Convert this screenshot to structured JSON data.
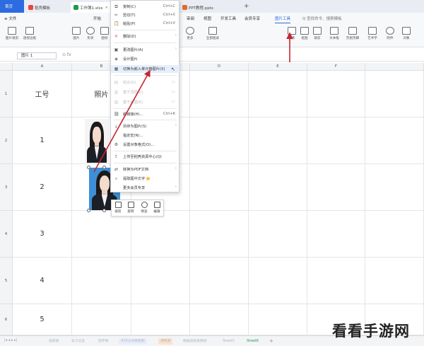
{
  "tabs": {
    "home": "首页",
    "items": [
      {
        "label": "稻壳模板",
        "color": "#e8463c"
      },
      {
        "label": "工作簿1.xlsx",
        "color": "#1e9a4f",
        "close": "×"
      },
      {
        "label": "PPT教程.pptx",
        "color": "#e06b2c"
      }
    ],
    "add": "+"
  },
  "menubar": {
    "items": [
      "≡ 文件",
      "开始",
      "审阅",
      "视图",
      "开发工具",
      "会员专享",
      "图片工具"
    ],
    "active": "图片工具",
    "search_hint": "Q 查找命令、搜索模板"
  },
  "ribbon": {
    "left": [
      "图片裁剪",
      "透视边框",
      "图片",
      "形状",
      "图标"
    ],
    "right": [
      "更多",
      "全部图表",
      "线条",
      "抠图",
      "裁剪",
      "文本框",
      "页眉页脚",
      "艺术字",
      "附件",
      "对象"
    ],
    "extra": [
      "数据透视图"
    ]
  },
  "formula": {
    "name_box": "图片 1",
    "fx": "⊙  fx"
  },
  "columns": [
    "A",
    "B",
    "C",
    "D",
    "E",
    "F"
  ],
  "rows": [
    "1",
    "2",
    "3",
    "4",
    "5",
    "6"
  ],
  "cells": {
    "a1": "工号",
    "b1": "照片",
    "a2": "1",
    "a3": "2",
    "a4": "3",
    "a5": "4",
    "a6": "5"
  },
  "context_menu": [
    {
      "icon": "⧉",
      "label": "复制(C)",
      "shortcut": "Ctrl+C"
    },
    {
      "icon": "✂",
      "label": "剪切(T)",
      "shortcut": "Ctrl+X"
    },
    {
      "icon": "📋",
      "label": "粘贴(P)",
      "shortcut": "Ctrl+V"
    },
    {
      "icon": "✕",
      "label": "删除(D)",
      "arrow": "›"
    },
    {
      "icon": "▣",
      "label": "更改图片(A)",
      "arrow": "›"
    },
    {
      "icon": "◈",
      "label": "设计图片"
    },
    {
      "icon": "▦",
      "label": "切换为嵌入单元格图片(X)"
    },
    {
      "icon": "▤",
      "label": "组合(G)",
      "disabled": true
    },
    {
      "icon": "▥",
      "label": "置于顶层(U)",
      "disabled": true
    },
    {
      "icon": "▧",
      "label": "置于底层(K)",
      "disabled": true
    },
    {
      "icon": "⛓",
      "label": "超链接(H)...",
      "shortcut": "Ctrl+K"
    },
    {
      "icon": "⤓",
      "label": "另存为图片(S)",
      "arrow": "›"
    },
    {
      "icon": "",
      "label": "指定宏(N)..."
    },
    {
      "icon": "⚙",
      "label": "设置对象格式(O)..."
    },
    {
      "icon": "⇪",
      "label": "上传至稻壳资源中心(Q)"
    },
    {
      "icon": "⇄",
      "label": "转换为PDF文档",
      "arrow": "›"
    },
    {
      "icon": "⌕",
      "label": "提取图中文字"
    },
    {
      "icon": "",
      "label": "更多会员专享",
      "arrow": "›"
    }
  ],
  "mini_toolbar": [
    "裁剪",
    "旋转",
    "预览",
    "编辑"
  ],
  "sheets": [
    "成绩表",
    "员工信息",
    "田字格",
    "XXX公司销售额",
    "课程表",
    "数据透视表教程",
    "Sheet5",
    "Sheet6"
  ],
  "sheet_active": "Sheet6",
  "sheet_nav": "|◂  ◂  ▸  ▸|",
  "watermark": "看看手游网",
  "accent": "#2d6be0",
  "arrow_color": "#c4262e"
}
